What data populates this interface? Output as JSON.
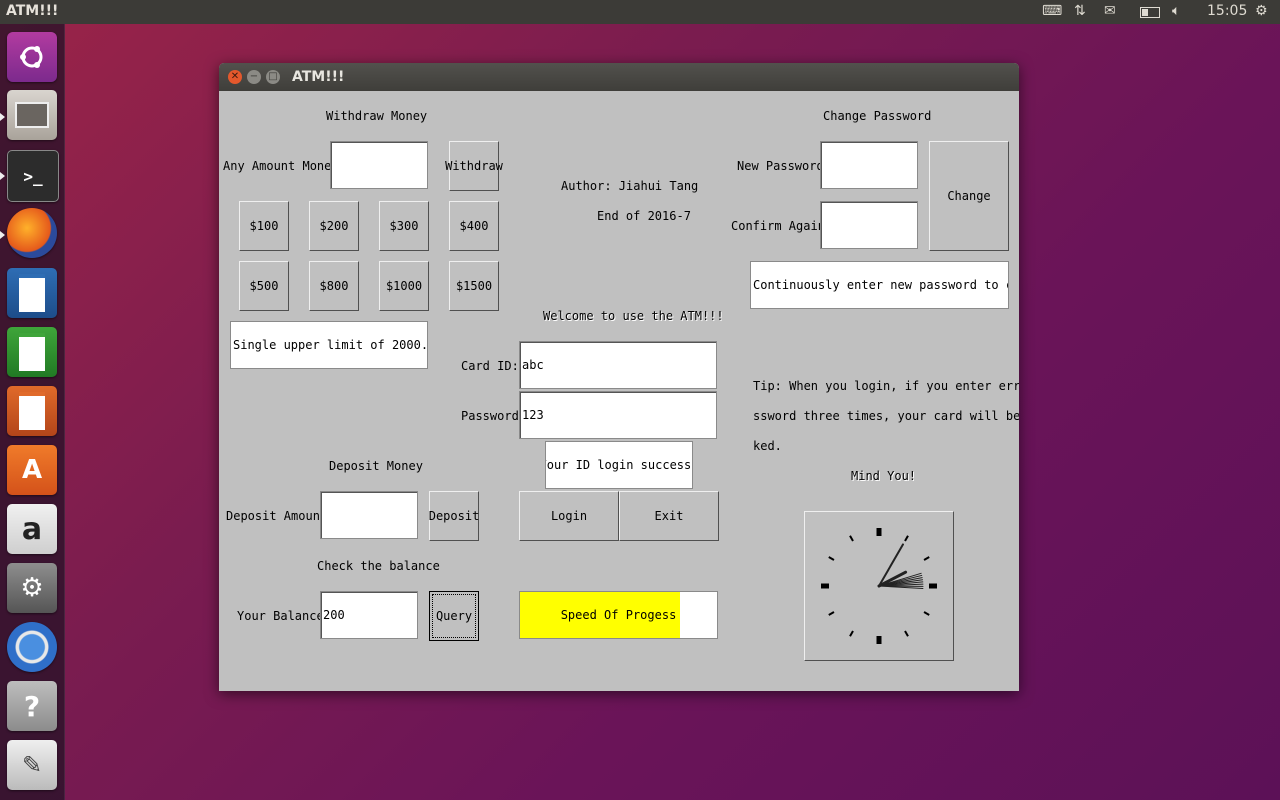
{
  "topbar": {
    "app_title": "ATM!!!",
    "time": "15:05"
  },
  "window": {
    "title": "ATM!!!"
  },
  "withdraw": {
    "heading": "Withdraw Money",
    "any_amount_label": "Any Amount Money:",
    "any_amount_value": "",
    "withdraw_button": "Withdraw",
    "quick_amounts": [
      "$100",
      "$200",
      "$300",
      "$400",
      "$500",
      "$800",
      "$1000",
      "$1500"
    ],
    "limit_note": "Single upper limit of 2000."
  },
  "info": {
    "author": "Author: Jiahui Tang",
    "date": "End of 2016-7",
    "welcome": "Welcome to use the ATM!!!"
  },
  "login": {
    "card_label": "Card  ID:",
    "card_value": "abc",
    "password_label": "Password:",
    "password_value": "123",
    "status": "Your ID login success!",
    "login_button": "Login",
    "exit_button": "Exit"
  },
  "change_password": {
    "heading": "Change Password",
    "new_label": "New Password:",
    "new_value": "",
    "confirm_label": "Confirm Again:",
    "confirm_value": "",
    "change_button": "Change",
    "note": "Continuously enter new password to change"
  },
  "tip": {
    "line1": "Tip: When you login, if you enter error pa",
    "line2": "ssword three times, your card will be cloc",
    "line3": "ked.",
    "mind": "Mind You!"
  },
  "deposit": {
    "heading": "Deposit Money",
    "label": "Deposit Amount:",
    "value": "",
    "button": "Deposit"
  },
  "balance": {
    "heading": "Check the balance",
    "label": "Your Balance:",
    "value": "200",
    "button": "Query"
  },
  "progress": {
    "label": "Speed Of Progess",
    "fraction": 0.81,
    "color": "#ffff00"
  },
  "clock": {
    "hour": 2,
    "minute": 5
  },
  "launcher": {
    "items": [
      "ubuntu-dash-icon",
      "files-icon",
      "terminal-icon",
      "firefox-icon",
      "writer-icon",
      "calc-icon",
      "impress-icon",
      "software-center-icon",
      "amazon-icon",
      "system-settings-icon",
      "chromium-icon",
      "help-icon",
      "text-editor-icon"
    ]
  }
}
